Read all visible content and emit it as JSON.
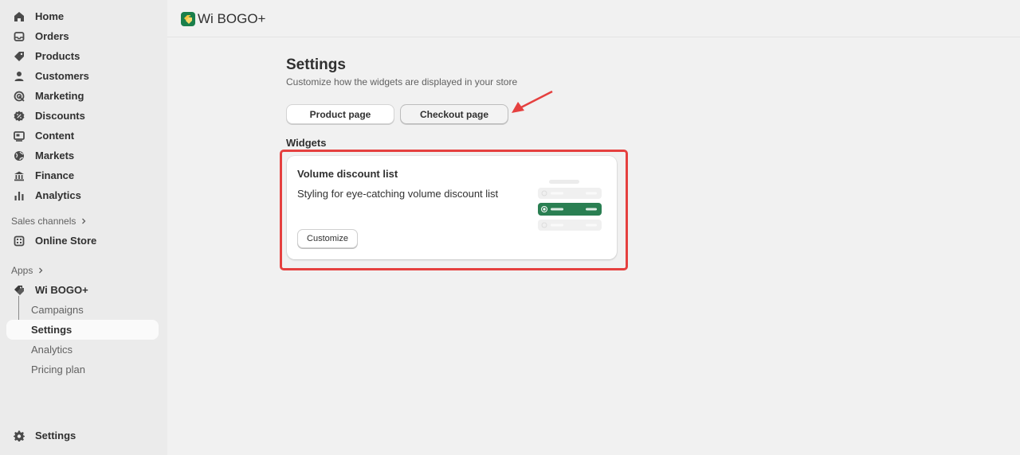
{
  "sidebar": {
    "nav": [
      {
        "label": "Home",
        "icon": "home-icon"
      },
      {
        "label": "Orders",
        "icon": "inbox-icon"
      },
      {
        "label": "Products",
        "icon": "tag-icon"
      },
      {
        "label": "Customers",
        "icon": "person-icon"
      },
      {
        "label": "Marketing",
        "icon": "target-icon"
      },
      {
        "label": "Discounts",
        "icon": "discount-icon"
      },
      {
        "label": "Content",
        "icon": "content-icon"
      },
      {
        "label": "Markets",
        "icon": "globe-icon"
      },
      {
        "label": "Finance",
        "icon": "bank-icon"
      },
      {
        "label": "Analytics",
        "icon": "bar-chart-icon"
      }
    ],
    "sales_channels_label": "Sales channels",
    "online_store_label": "Online Store",
    "apps_label": "Apps",
    "app_name": "Wi BOGO+",
    "app_subitems": [
      "Campaigns",
      "Settings",
      "Analytics",
      "Pricing plan"
    ],
    "settings_label": "Settings"
  },
  "header": {
    "app_title": "Wi BOGO+"
  },
  "page": {
    "title": "Settings",
    "subtitle": "Customize how the widgets are displayed in your store",
    "tabs": [
      "Product page",
      "Checkout page"
    ],
    "widgets_title": "Widgets",
    "card": {
      "title": "Volume discount list",
      "description": "Styling for eye-catching volume discount list",
      "button_label": "Customize"
    }
  },
  "colors": {
    "accent_green": "#2a7f52",
    "annotation_red": "#e5403f"
  }
}
